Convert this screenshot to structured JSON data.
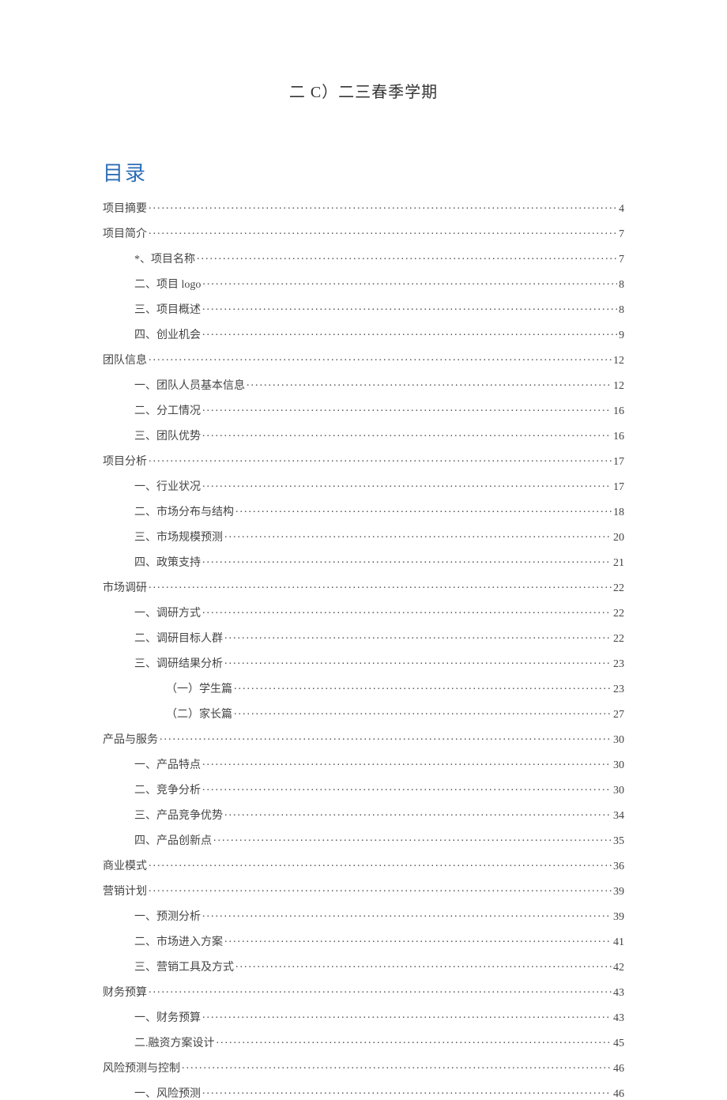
{
  "header_title": "二 C）二三春季学期",
  "toc_heading": "目录",
  "toc": [
    {
      "label": "项目摘要",
      "page": "4",
      "indent": 0
    },
    {
      "label": "项目简介",
      "page": "7",
      "indent": 0
    },
    {
      "label": "*、项目名称",
      "page": "7",
      "indent": 1
    },
    {
      "label": "二、项目 logo",
      "page": "8",
      "indent": 1
    },
    {
      "label": "三、项目概述",
      "page": "8",
      "indent": 1
    },
    {
      "label": "四、创业机会",
      "page": "9",
      "indent": 1
    },
    {
      "label": "团队信息",
      "page": "12",
      "indent": 0
    },
    {
      "label": "一、团队人员基本信息",
      "page": "12",
      "indent": 1
    },
    {
      "label": "二、分工情况",
      "page": "16",
      "indent": 1
    },
    {
      "label": "三、团队优势",
      "page": "16",
      "indent": 1
    },
    {
      "label": "项目分析",
      "page": "17",
      "indent": 0
    },
    {
      "label": "一、行业状况",
      "page": "17",
      "indent": 1
    },
    {
      "label": "二、市场分布与结构",
      "page": "18",
      "indent": 1
    },
    {
      "label": "三、市场规模预测",
      "page": "20",
      "indent": 1
    },
    {
      "label": "四、政策支持",
      "page": "21",
      "indent": 1
    },
    {
      "label": "市场调研",
      "page": "22",
      "indent": 0
    },
    {
      "label": "一、调研方式",
      "page": "22",
      "indent": 1
    },
    {
      "label": "二、调研目标人群",
      "page": "22",
      "indent": 1
    },
    {
      "label": "三、调研结果分析",
      "page": "23",
      "indent": 1
    },
    {
      "label": "（一）学生篇",
      "page": "23",
      "indent": 2
    },
    {
      "label": "（二）家长篇",
      "page": "27",
      "indent": 2
    },
    {
      "label": "产品与服务",
      "page": "30",
      "indent": 0
    },
    {
      "label": "一、产品特点",
      "page": "30",
      "indent": 1
    },
    {
      "label": "二、竞争分析",
      "page": "30",
      "indent": 1
    },
    {
      "label": "三、产品竞争优势",
      "page": "34",
      "indent": 1
    },
    {
      "label": "四、产品创新点",
      "page": "35",
      "indent": 1
    },
    {
      "label": "商业模式",
      "page": "36",
      "indent": 0
    },
    {
      "label": "营销计划",
      "page": "39",
      "indent": 0
    },
    {
      "label": "一、预测分析",
      "page": "39",
      "indent": 1
    },
    {
      "label": "二、市场进入方案",
      "page": "41",
      "indent": 1
    },
    {
      "label": "三、营销工具及方式",
      "page": "42",
      "indent": 1
    },
    {
      "label": "财务预算",
      "page": "43",
      "indent": 0
    },
    {
      "label": "一、财务预算",
      "page": "43",
      "indent": 1
    },
    {
      "label": "二.融资方案设计",
      "page": "45",
      "indent": 1
    },
    {
      "label": "风险预测与控制",
      "page": "46",
      "indent": 0
    },
    {
      "label": "一、风险预测",
      "page": "46",
      "indent": 1
    }
  ]
}
